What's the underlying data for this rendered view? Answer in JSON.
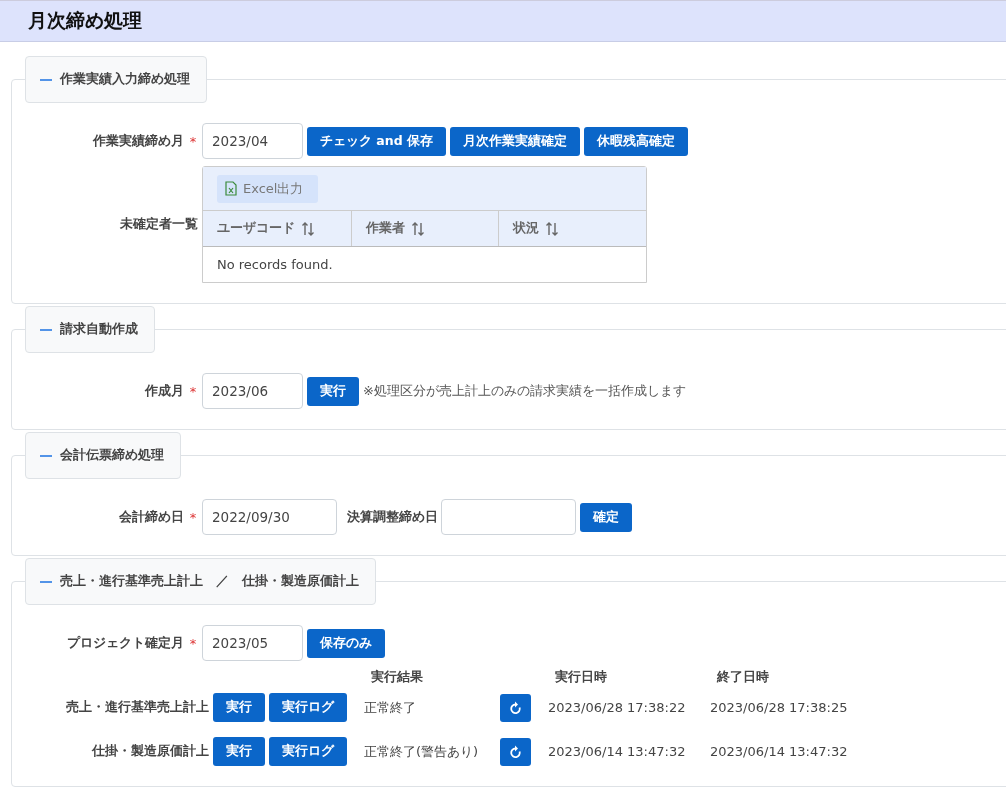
{
  "header": {
    "title": "月次締め処理"
  },
  "required_mark": "*",
  "sections": [
    {
      "kind": "work_closing",
      "title": "作業実績入力締め処理",
      "expanded": true,
      "field": {
        "label": "作業実績締め月",
        "required": true,
        "value": "2023/04"
      },
      "buttons": [
        "チェック and 保存",
        "月次作業実績確定",
        "休暇残高確定"
      ],
      "list_label": "未確定者一覧",
      "export_button": "Excel出力",
      "columns": [
        "ユーザコード",
        "作業者",
        "状況"
      ],
      "empty_message": "No records found."
    },
    {
      "kind": "billing",
      "title": "請求自動作成",
      "expanded": true,
      "field": {
        "label": "作成月",
        "required": true,
        "value": "2023/06"
      },
      "button": "実行",
      "note": "※処理区分が売上計上のみの請求実績を一括作成します"
    },
    {
      "kind": "accounting",
      "title": "会計伝票締め処理",
      "expanded": true,
      "field": {
        "label": "会計締め日",
        "required": true,
        "value": "2022/09/30"
      },
      "field_2": {
        "label": "決算調整締め日"
      },
      "button": "確定"
    },
    {
      "kind": "project",
      "title": "売上・進行基準売上計上　／　仕掛・製造原価計上",
      "expanded": true,
      "field": {
        "label": "プロジェクト確定月",
        "required": true,
        "value": "2023/05"
      },
      "button": "保存のみ",
      "result_headers": [
        "実行結果",
        "実行日時",
        "終了日時"
      ],
      "jobs": [
        {
          "label": "売上・進行基準売上計上",
          "run_button": "実行",
          "log_button": "実行ログ",
          "result": "正常終了",
          "started": "2023/06/28 17:38:22",
          "ended": "2023/06/28 17:38:25"
        },
        {
          "label": "仕掛・製造原価計上",
          "run_button": "実行",
          "log_button": "実行ログ",
          "result": "正常終了(警告あり)",
          "started": "2023/06/14 13:47:32",
          "ended": "2023/06/14 13:47:32"
        }
      ]
    }
  ]
}
